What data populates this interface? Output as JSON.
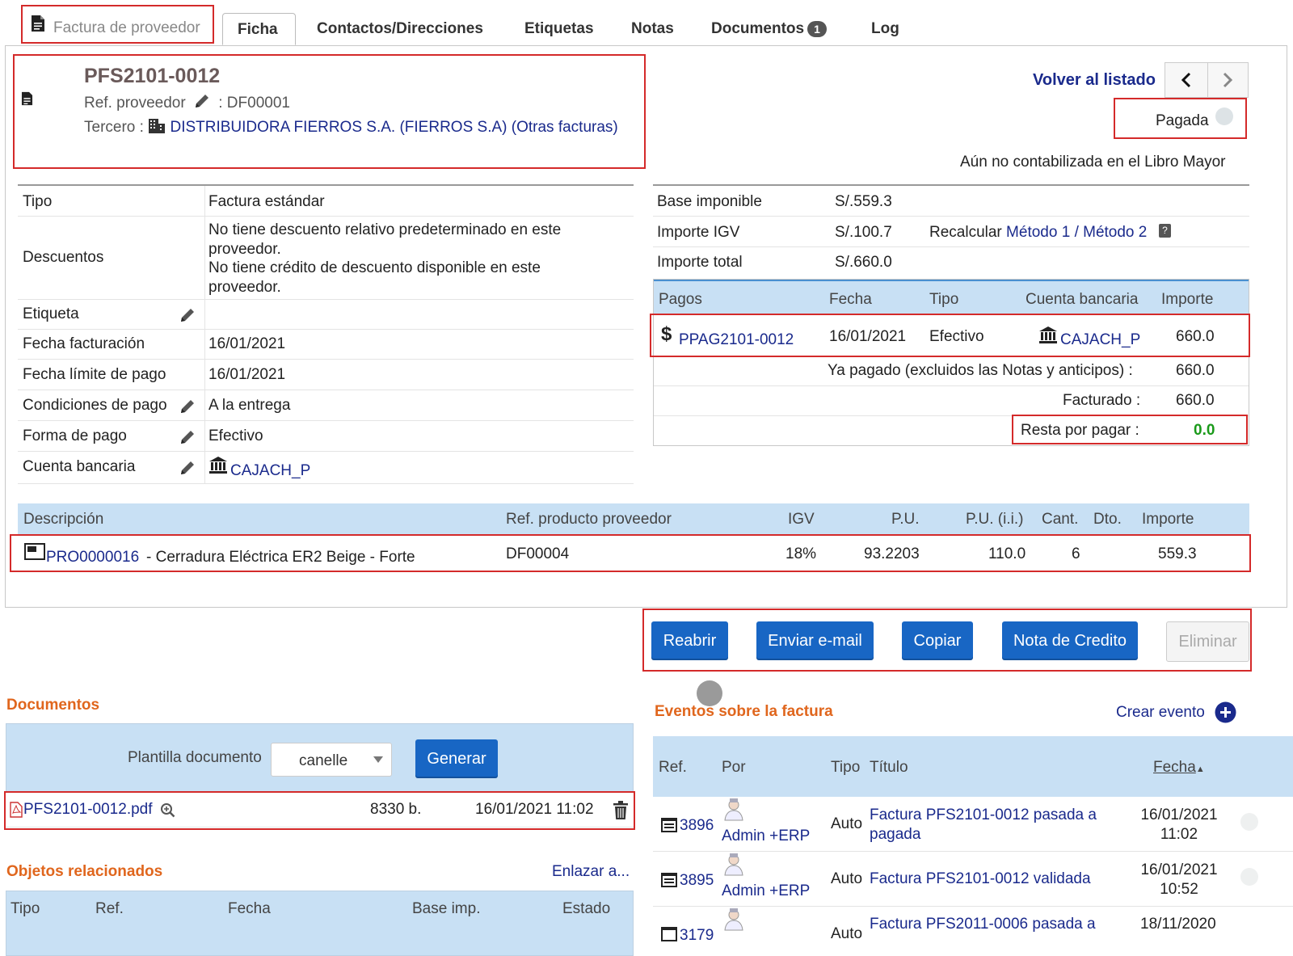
{
  "tabs": {
    "card_title": "Factura de proveedor",
    "items": [
      "Ficha",
      "Contactos/Direcciones",
      "Etiquetas",
      "Notas",
      "Documentos",
      "Log"
    ],
    "documents_count": "1"
  },
  "header": {
    "ref": "PFS2101-0012",
    "ref_supplier_label": "Ref. proveedor",
    "ref_supplier_value": ": DF00001",
    "third_party_label": "Tercero :",
    "third_party_name": "DISTRIBUIDORA FIERROS S.A. (FIERROS S.A)",
    "other_invoices": "(Otras facturas)",
    "back_to_list": "Volver al listado",
    "status": "Pagada",
    "ledger_note": "Aún no contabilizada en el Libro Mayor"
  },
  "left_fields": [
    {
      "label": "Tipo",
      "value": "Factura estándar"
    },
    {
      "label": "Descuentos",
      "value": [
        "No tiene descuento relativo predeterminado en este",
        "proveedor.",
        "No tiene crédito de descuento disponible en este",
        "proveedor."
      ]
    },
    {
      "label": "Etiqueta",
      "value": ""
    },
    {
      "label": "Fecha facturación",
      "value": "16/01/2021"
    },
    {
      "label": "Fecha límite de pago",
      "value": "16/01/2021"
    },
    {
      "label": "Condiciones de pago",
      "value": "A la entrega"
    },
    {
      "label": "Forma de pago",
      "value": "Efectivo"
    },
    {
      "label": "Cuenta bancaria",
      "value": "CAJACH_P"
    }
  ],
  "amounts": {
    "base_label": "Base imponible",
    "base_value": "S/.559.3",
    "igv_label": "Importe IGV",
    "igv_value": "S/.100.7",
    "recalc_label": "Recalcular",
    "method1": "Método 1",
    "slash": "/",
    "method2": "Método 2",
    "total_label": "Importe total",
    "total_value": "S/.660.0"
  },
  "payments": {
    "headers": [
      "Pagos",
      "Fecha",
      "Tipo",
      "Cuenta bancaria",
      "Importe"
    ],
    "row": {
      "ref": "PPAG2101-0012",
      "date": "16/01/2021",
      "type": "Efectivo",
      "account": "CAJACH_P",
      "amount": "660.0"
    },
    "already_paid_label": "Ya pagado (excluidos las Notas y anticipos) :",
    "already_paid_value": "660.0",
    "invoiced_label": "Facturado :",
    "invoiced_value": "660.0",
    "remaining_label": "Resta por pagar :",
    "remaining_value": "0.0"
  },
  "lines": {
    "headers": [
      "Descripción",
      "Ref. producto proveedor",
      "IGV",
      "P.U.",
      "P.U. (i.i.)",
      "Cant.",
      "Dto.",
      "Importe"
    ],
    "row": {
      "product_ref": "PRO0000016",
      "product_desc": "- Cerradura Eléctrica ER2 Beige - Forte",
      "supplier_ref": "DF00004",
      "igv": "18%",
      "pu": "93.2203",
      "pu_ii": "110.0",
      "qty": "6",
      "discount": "",
      "amount": "559.3"
    }
  },
  "actions": {
    "reopen": "Reabrir",
    "send_email": "Enviar e-mail",
    "copy": "Copiar",
    "credit_note": "Nota de Credito",
    "delete": "Eliminar"
  },
  "documents": {
    "title": "Documentos",
    "template_label": "Plantilla documento",
    "template_value": "canelle",
    "generate": "Generar",
    "file": {
      "name": "PFS2101-0012.pdf",
      "size": "8330 b.",
      "date": "16/01/2021 11:02"
    }
  },
  "related": {
    "title": "Objetos relacionados",
    "link": "Enlazar a...",
    "headers": [
      "Tipo",
      "Ref.",
      "Fecha",
      "Base imp.",
      "Estado"
    ]
  },
  "events": {
    "title": "Eventos sobre la factura",
    "create": "Crear evento",
    "headers": [
      "Ref.",
      "Por",
      "Tipo",
      "Título",
      "Fecha"
    ],
    "rows": [
      {
        "ref": "3896",
        "by": "Admin +ERP",
        "type": "Auto",
        "title": [
          "Factura PFS2101-0012 pasada a",
          "pagada"
        ],
        "date": [
          "16/01/2021",
          "11:02"
        ]
      },
      {
        "ref": "3895",
        "by": "Admin +ERP",
        "type": "Auto",
        "title": [
          "Factura PFS2101-0012 validada"
        ],
        "date": [
          "16/01/2021",
          "10:52"
        ]
      },
      {
        "ref": "3179",
        "by": "",
        "type": "Auto",
        "title": [
          "Factura PFS2011-0006 pasada a"
        ],
        "date": [
          "18/11/2020"
        ]
      }
    ]
  },
  "colors": {
    "link": "#1a2a8c",
    "section": "#e0661d",
    "button": "#1866c4",
    "header_bg": "#c8e0f4",
    "highlight_box": "#d42a2a",
    "remaining_green": "#1a9a1a"
  }
}
